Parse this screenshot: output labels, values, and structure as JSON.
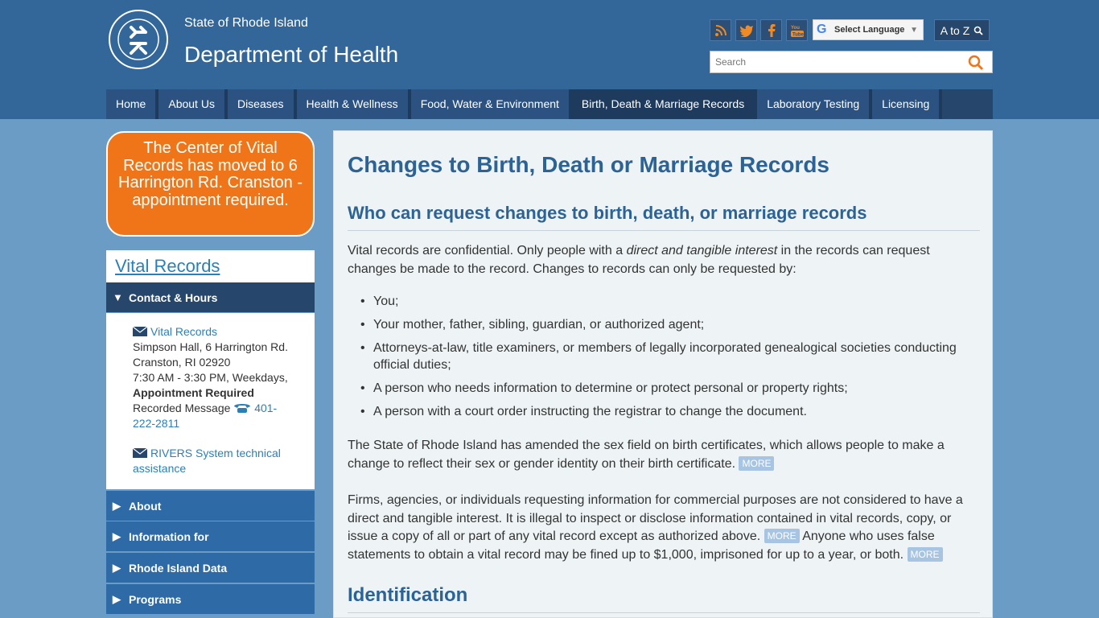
{
  "header": {
    "state_name": "State of Rhode Island",
    "dept_name": "Department of Health",
    "language_label": "Select Language",
    "atoz_label": "A to Z",
    "search_placeholder": "Search",
    "social_icons": [
      "rss-icon",
      "twitter-icon",
      "facebook-icon",
      "youtube-icon"
    ]
  },
  "nav": {
    "items": [
      {
        "label": "Home"
      },
      {
        "label": "About Us"
      },
      {
        "label": "Diseases"
      },
      {
        "label": "Health & Wellness"
      },
      {
        "label": "Food, Water & Environment"
      },
      {
        "label": "Birth, Death & Marriage Records",
        "active": true
      },
      {
        "label": "Laboratory Testing"
      },
      {
        "label": "Licensing"
      }
    ]
  },
  "banner": {
    "text": "The Center of Vital Records has moved to 6 Harrington Rd. Cranston - appointment required."
  },
  "sidebar": {
    "title": "Vital Records",
    "contact_heading": "Contact & Hours",
    "contact": {
      "link1": "Vital Records",
      "line1": "Simpson Hall, 6 Harrington Rd.",
      "line2": "Cranston, RI 02920",
      "line3": "7:30 AM - 3:30 PM, Weekdays,",
      "bold": "Appointment Required",
      "phone_label": "Recorded Message",
      "phone": "401-222-2811",
      "link2": "RIVERS System technical assistance"
    },
    "sections": [
      "About",
      "Information for",
      "Rhode Island Data",
      "Programs"
    ]
  },
  "main": {
    "title": "Changes to Birth, Death or Marriage Records",
    "subtitle1": "Who can request changes to birth, death, or marriage records",
    "intro_a": "Vital records are confidential. Only people with a ",
    "intro_em": "direct and tangible interest",
    "intro_b": " in the records can request changes be made to the record. Changes to records can only be requested by:",
    "list": [
      "You;",
      "Your mother, father, sibling, guardian, or authorized agent;",
      "Attorneys-at-law, title examiners, or members of legally incorporated genealogical societies conducting official duties;",
      "A person who needs information to determine or protect personal or property rights;",
      "A person with a court order instructing the registrar to change the document."
    ],
    "sex_para": "The State of Rhode Island has amended the sex field on birth certificates, which allows people to make a change to reflect their sex or gender identity on their birth certificate.",
    "firms_para_a": "Firms, agencies, or individuals requesting information for commercial purposes are not considered to have a direct and tangible interest. It is illegal to inspect or disclose information contained in vital records, copy, or issue a copy of all or part of any vital record except as authorized above.",
    "firms_para_b": "Anyone who uses false statements to obtain a vital record may be fined up to $1,000, imprisoned for up to a year, or both.",
    "more_label": "MORE",
    "subtitle2": "Identification"
  }
}
